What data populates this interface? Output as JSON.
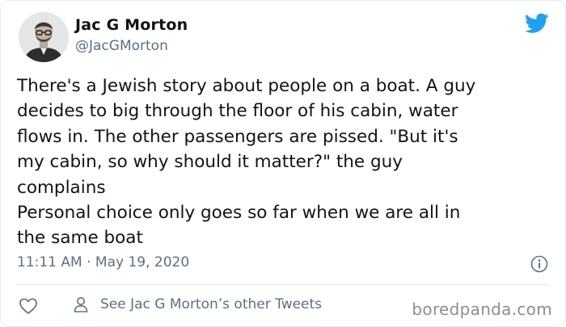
{
  "author": {
    "display_name": "Jac G Morton",
    "handle": "@JacGMorton",
    "avatar_icon": "portrait-photo"
  },
  "platform_icon": "twitter-bird-icon",
  "tweet": {
    "lines": [
      "There's a Jewish story about people on a boat. A guy",
      "decides to big through the floor of his cabin, water",
      "flows in. The other passengers are pissed. \"But it's",
      "my cabin, so why should it matter?\" the guy",
      "complains",
      "Personal choice only goes so far when we are all in",
      "the same boat"
    ],
    "timestamp": "11:11 AM · May 19, 2020"
  },
  "actions": {
    "like_icon": "heart-icon",
    "other_tweets_icon": "person-icon",
    "other_tweets_label": "See Jac G Morton’s other Tweets",
    "info_icon": "info-icon"
  },
  "watermark": "boredpanda.com",
  "colors": {
    "twitter_blue": "#1da1f2",
    "secondary_text": "#5b7083",
    "divider": "#e1e8ed"
  }
}
